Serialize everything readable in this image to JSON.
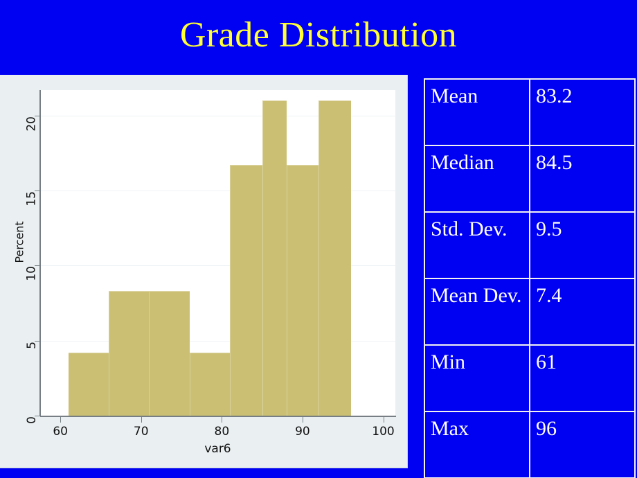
{
  "slide": {
    "title": "Grade Distribution",
    "background_color": "#0000f2",
    "title_color": "#ffff33"
  },
  "stats_table": {
    "rows": [
      {
        "label": "Mean",
        "value": "83.2"
      },
      {
        "label": "Median",
        "value": "84.5"
      },
      {
        "label": "Std. Dev.",
        "value": "9.5"
      },
      {
        "label": "Mean Dev.",
        "value": "7.4"
      },
      {
        "label": "Min",
        "value": "61"
      },
      {
        "label": "Max",
        "value": "96"
      }
    ]
  },
  "chart_data": {
    "type": "bar",
    "title": "",
    "xlabel": "var6",
    "ylabel": "Percent",
    "xlim": [
      57.5,
      101.5
    ],
    "ylim": [
      0,
      21.7
    ],
    "xticks": [
      60,
      70,
      80,
      90,
      100
    ],
    "yticks": [
      0,
      5,
      10,
      15,
      20
    ],
    "grid": true,
    "bar_color": "#cbbf74",
    "plot_background": "#ffffff",
    "panel_background": "#eaf0f2",
    "bin_edges": [
      61,
      66,
      71,
      76,
      81,
      86,
      91,
      96
    ],
    "categories": [
      "61-66",
      "66-71",
      "71-76",
      "76-81",
      "81-86",
      "86-91",
      "91-96"
    ],
    "values": [
      4.2,
      8.3,
      8.3,
      4.2,
      16.7,
      21.0,
      16.7,
      21.0
    ],
    "bars": [
      {
        "x0": 61,
        "x1": 66,
        "value": 4.2
      },
      {
        "x0": 66,
        "x1": 71,
        "value": 8.3
      },
      {
        "x0": 71,
        "x1": 76,
        "value": 8.3
      },
      {
        "x0": 76,
        "x1": 81,
        "value": 4.2
      },
      {
        "x0": 81,
        "x1": 85,
        "value": 16.7
      },
      {
        "x0": 85,
        "x1": 88,
        "value": 21.0
      },
      {
        "x0": 88,
        "x1": 92,
        "value": 16.7
      },
      {
        "x0": 92,
        "x1": 96,
        "value": 21.0
      }
    ]
  }
}
